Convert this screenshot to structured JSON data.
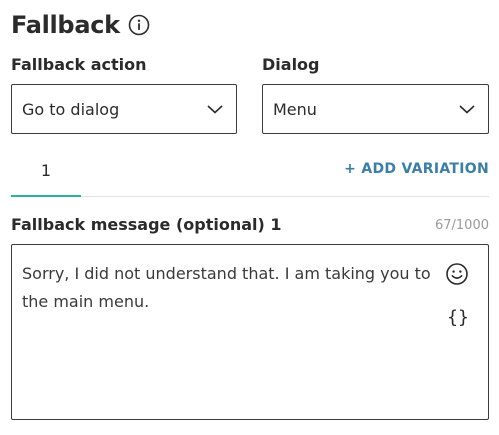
{
  "header": {
    "title": "Fallback",
    "info_icon": "info-circle-icon"
  },
  "fallback_action": {
    "label": "Fallback action",
    "value": "Go to dialog"
  },
  "dialog": {
    "label": "Dialog",
    "value": "Menu"
  },
  "variations": {
    "tabs": [
      {
        "label": "1",
        "active": true
      }
    ],
    "add_label": "+ ADD VARIATION",
    "accent_color": "#2bb39a",
    "link_color": "#3b7ea6"
  },
  "message": {
    "label": "Fallback message (optional) 1",
    "counter": "67/1000",
    "text": "Sorry, I did not understand that. I am taking you to the main menu.",
    "emoji_icon": "smiley-icon",
    "variable_button": "{}"
  }
}
